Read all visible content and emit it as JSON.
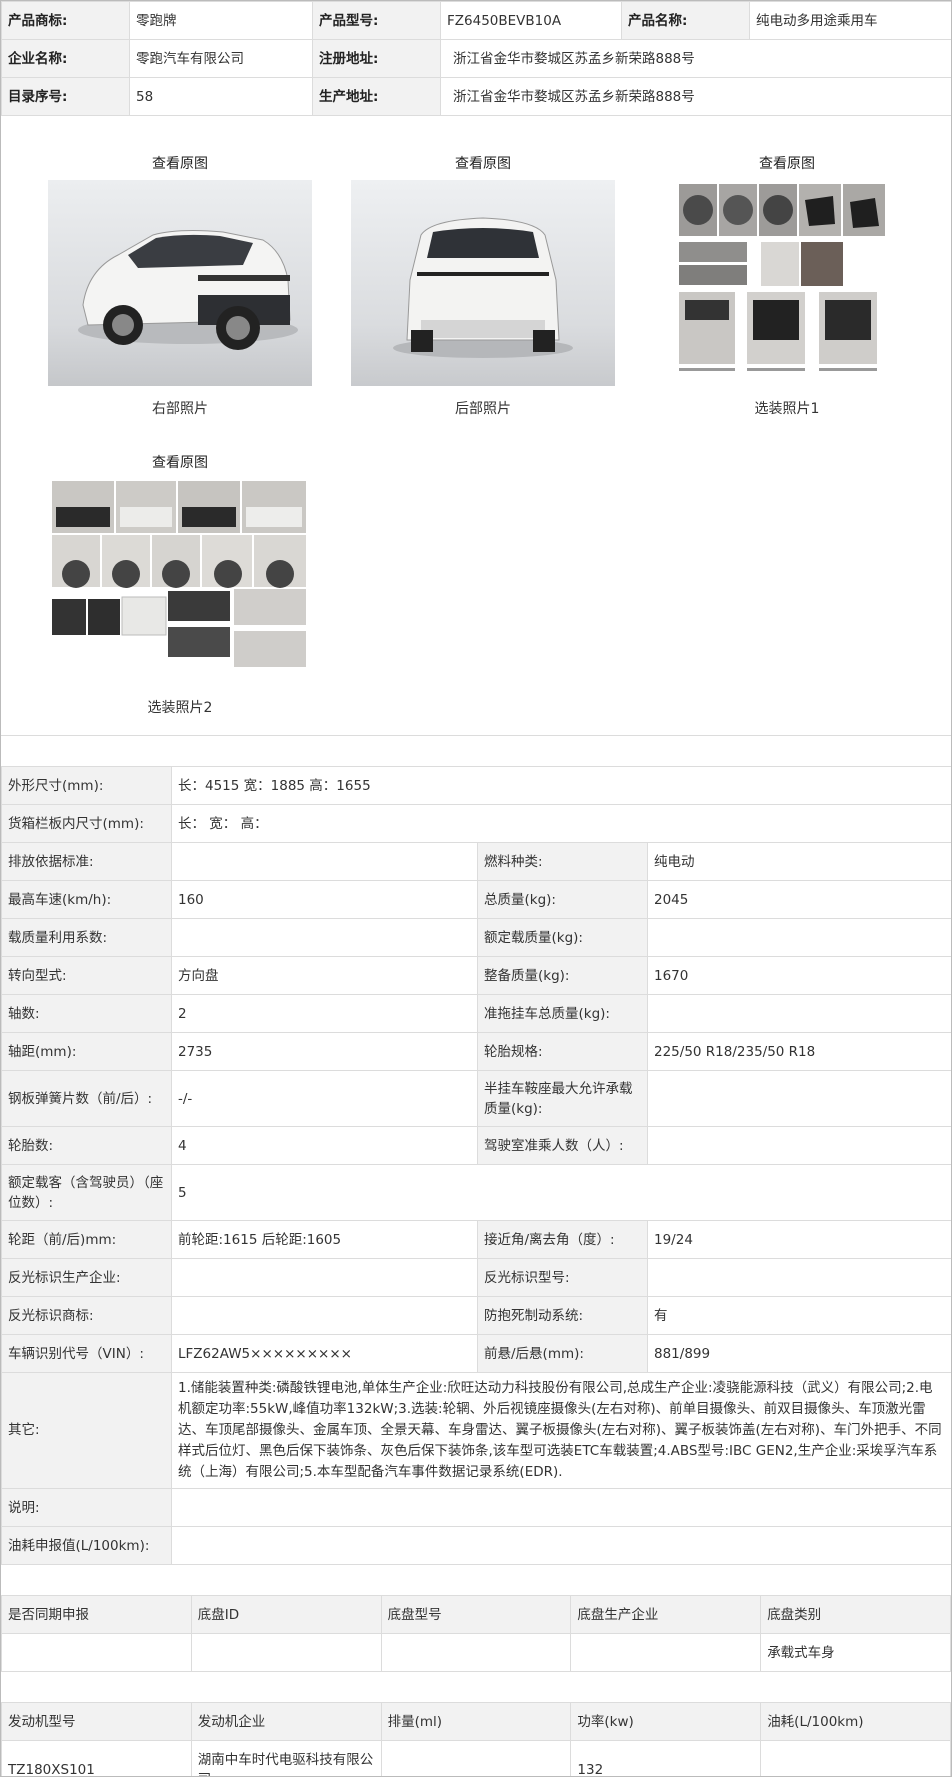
{
  "info": {
    "rows": [
      [
        {
          "label": "产品商标:",
          "value": "零跑牌"
        },
        {
          "label": "产品型号:",
          "value": "FZ6450BEVB10A"
        },
        {
          "label": "产品名称:",
          "value": "纯电动多用途乘用车"
        }
      ],
      [
        {
          "label": "企业名称:",
          "value": "零跑汽车有限公司"
        },
        {
          "label": "注册地址:",
          "value": "浙江省金华市婺城区苏孟乡新荣路888号"
        }
      ],
      [
        {
          "label": "目录序号:",
          "value": "58"
        },
        {
          "label": "生产地址:",
          "value": "浙江省金华市婺城区苏孟乡新荣路888号"
        }
      ]
    ]
  },
  "photos": [
    {
      "link": "查看原图",
      "caption": "右部照片"
    },
    {
      "link": "查看原图",
      "caption": "后部照片"
    },
    {
      "link": "查看原图",
      "caption": "选装照片1"
    },
    {
      "link": "查看原图",
      "caption": "选装照片2"
    }
  ],
  "specs": {
    "dimensions": {
      "label": "外形尺寸(mm):",
      "value": "长：4515 宽：1885 高：1655"
    },
    "cargo": {
      "label": "货箱栏板内尺寸(mm):",
      "value": "长：  宽：  高："
    },
    "pairs": [
      [
        {
          "label": "排放依据标准:",
          "value": ""
        },
        {
          "label": "燃料种类:",
          "value": "纯电动"
        }
      ],
      [
        {
          "label": "最高车速(km/h):",
          "value": "160"
        },
        {
          "label": "总质量(kg):",
          "value": "2045"
        }
      ],
      [
        {
          "label": "载质量利用系数:",
          "value": ""
        },
        {
          "label": "额定载质量(kg):",
          "value": ""
        }
      ],
      [
        {
          "label": "转向型式:",
          "value": "方向盘"
        },
        {
          "label": "整备质量(kg):",
          "value": "1670"
        }
      ],
      [
        {
          "label": "轴数:",
          "value": "2"
        },
        {
          "label": "准拖挂车总质量(kg):",
          "value": ""
        }
      ],
      [
        {
          "label": "轴距(mm):",
          "value": "2735"
        },
        {
          "label": "轮胎规格:",
          "value": "225/50 R18/235/50 R18"
        }
      ],
      [
        {
          "label": "钢板弹簧片数（前/后）:",
          "value": "-/-"
        },
        {
          "label": "半挂车鞍座最大允许承载质量(kg):",
          "value": ""
        }
      ],
      [
        {
          "label": "轮胎数:",
          "value": "4"
        },
        {
          "label": "驾驶室准乘人数（人）:",
          "value": ""
        }
      ]
    ],
    "seats": {
      "label": "额定载客（含驾驶员）（座位数）:",
      "value": "5"
    },
    "pairs2": [
      [
        {
          "label": "轮距（前/后)mm:",
          "value": "前轮距:1615 后轮距:1605"
        },
        {
          "label": "接近角/离去角（度）:",
          "value": "19/24"
        }
      ],
      [
        {
          "label": "反光标识生产企业:",
          "value": ""
        },
        {
          "label": "反光标识型号:",
          "value": ""
        }
      ],
      [
        {
          "label": "反光标识商标:",
          "value": ""
        },
        {
          "label": "防抱死制动系统:",
          "value": "有"
        }
      ],
      [
        {
          "label": "车辆识别代号（VIN）:",
          "value": "LFZ62AW5×××××××××"
        },
        {
          "label": "前悬/后悬(mm):",
          "value": "881/899"
        }
      ]
    ],
    "other": {
      "label": "其它:",
      "value": "1.储能装置种类:磷酸铁锂电池,单体生产企业:欣旺达动力科技股份有限公司,总成生产企业:凌骁能源科技（武义）有限公司;2.电机额定功率:55kW,峰值功率132kW;3.选装:轮辋、外后视镜座摄像头(左右对称)、前单目摄像头、前双目摄像头、车顶激光雷达、车顶尾部摄像头、金属车顶、全景天幕、车身雷达、翼子板摄像头(左右对称)、翼子板装饰盖(左右对称)、车门外把手、不同样式后位灯、黑色后保下装饰条、灰色后保下装饰条,该车型可选装ETC车载装置;4.ABS型号:IBC GEN2,生产企业:采埃孚汽车系统（上海）有限公司;5.本车型配备汽车事件数据记录系统(EDR)."
    },
    "note": {
      "label": "说明:",
      "value": ""
    },
    "fuel": {
      "label": "油耗申报值(L/100km):",
      "value": ""
    }
  },
  "chassis": {
    "headers": [
      "是否同期申报",
      "底盘ID",
      "底盘型号",
      "底盘生产企业",
      "底盘类别"
    ],
    "row": [
      "",
      "",
      "",
      "",
      "承载式车身"
    ]
  },
  "engine": {
    "headers": [
      "发动机型号",
      "发动机企业",
      "排量(ml)",
      "功率(kw)",
      "油耗(L/100km)"
    ],
    "row": [
      "TZ180XS101",
      "湖南中车时代电驱科技有限公司",
      "",
      "132",
      ""
    ]
  }
}
